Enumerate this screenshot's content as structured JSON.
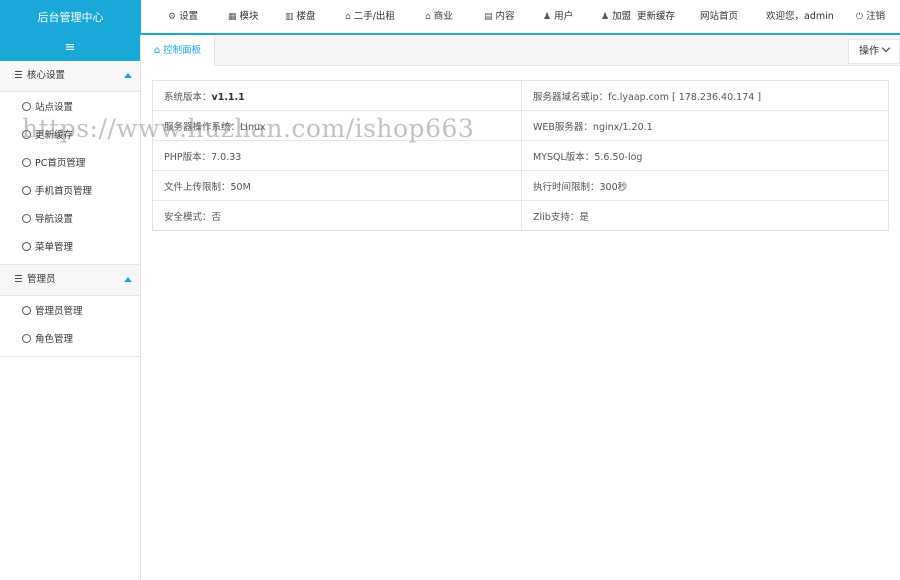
{
  "header": {
    "app_title": "后台管理中心",
    "nav": [
      {
        "icon": "gear-icon",
        "glyph": "⚙",
        "label": "设置"
      },
      {
        "icon": "grid-icon",
        "glyph": "▦",
        "label": "模块"
      },
      {
        "icon": "building-icon",
        "glyph": "▥",
        "label": "楼盘"
      },
      {
        "icon": "tag-icon",
        "glyph": "⌂",
        "label": "二手/出租"
      },
      {
        "icon": "shop-icon",
        "glyph": "⌂",
        "label": "商业"
      },
      {
        "icon": "doc-icon",
        "glyph": "▤",
        "label": "内容"
      },
      {
        "icon": "user-icon",
        "glyph": "♟",
        "label": "用户"
      },
      {
        "icon": "users-icon",
        "glyph": "♟",
        "label": "加盟"
      },
      {
        "icon": "",
        "glyph": "",
        "label": "更新缓存"
      },
      {
        "icon": "",
        "glyph": "",
        "label": "网站首页"
      },
      {
        "icon": "",
        "glyph": "",
        "label": "欢迎您，admin"
      },
      {
        "icon": "power-icon",
        "glyph": "⏻",
        "label": "注销"
      }
    ]
  },
  "sidebar": {
    "toggle_glyph": "≡",
    "groups": [
      {
        "title": "核心设置",
        "items": [
          "站点设置",
          "更新缓存",
          "PC首页管理",
          "手机首页管理",
          "导航设置",
          "菜单管理"
        ]
      },
      {
        "title": "管理员",
        "items": [
          "管理员管理",
          "角色管理"
        ]
      }
    ]
  },
  "tabs": {
    "home_label": "控制面板",
    "home_glyph": "⌂",
    "ops_label": "操作"
  },
  "info": {
    "rows": [
      [
        {
          "label": "系统版本：",
          "value": "v1.1.1",
          "bold": true
        },
        {
          "label": "服务器域名或ip：",
          "value": "fc.lyaap.com [ 178.236.40.174 ]"
        }
      ],
      [
        {
          "label": "服务器操作系统：",
          "value": "Linux"
        },
        {
          "label": "WEB服务器：",
          "value": "nginx/1.20.1"
        }
      ],
      [
        {
          "label": "PHP版本：",
          "value": "7.0.33"
        },
        {
          "label": "MYSQL版本：",
          "value": "5.6.50-log"
        }
      ],
      [
        {
          "label": "文件上传限制：",
          "value": "50M"
        },
        {
          "label": "执行时间限制：",
          "value": "300秒"
        }
      ],
      [
        {
          "label": "安全模式：",
          "value": "否"
        },
        {
          "label": "Zlib支持：",
          "value": "是"
        }
      ]
    ]
  },
  "watermark": "https://www.huzhan.com/ishop663"
}
